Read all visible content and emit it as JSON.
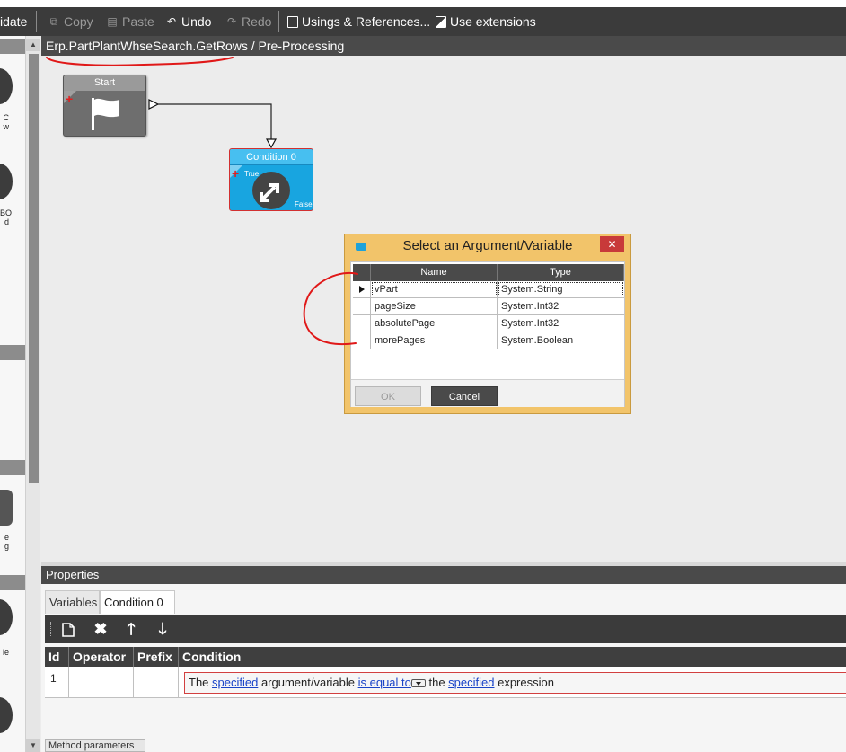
{
  "toolbar": {
    "validate_label": "idate",
    "copy_label": "Copy",
    "paste_label": "Paste",
    "undo_label": "Undo",
    "redo_label": "Redo",
    "usings_label": "Usings & References...",
    "extensions_label": "Use extensions"
  },
  "left_palette": {
    "items": [
      {
        "text": "C\nw"
      },
      {
        "text": "BO\nd"
      },
      {
        "text": "e\ng"
      },
      {
        "text": "le"
      }
    ]
  },
  "breadcrumb": {
    "method": "Erp.PartPlantWhseSearch.GetRows",
    "separator": " / ",
    "stage": "Pre-Processing"
  },
  "workflow": {
    "start_node": {
      "title": "Start"
    },
    "condition_node": {
      "title": "Condition 0",
      "true_label": "True",
      "false_label": "False"
    }
  },
  "dialog": {
    "title": "Select an Argument/Variable",
    "close_label": "✕",
    "columns": [
      "Name",
      "Type"
    ],
    "rows": [
      {
        "name": "vPart",
        "type": "System.String",
        "selected": true
      },
      {
        "name": "pageSize",
        "type": "System.Int32",
        "selected": false
      },
      {
        "name": "absolutePage",
        "type": "System.Int32",
        "selected": false
      },
      {
        "name": "morePages",
        "type": "System.Boolean",
        "selected": false
      }
    ],
    "ok_label": "OK",
    "cancel_label": "Cancel"
  },
  "properties": {
    "title": "Properties",
    "tabs": [
      "Variables",
      "Condition 0"
    ],
    "active_tab": "Condition 0",
    "toolbar_icons": [
      "new-document-icon",
      "delete-icon",
      "move-up-icon",
      "move-down-icon"
    ],
    "columns": [
      "Id",
      "Operator",
      "Prefix",
      "Condition"
    ],
    "rows": [
      {
        "id": "1",
        "operator": "",
        "prefix": "",
        "condition": {
          "part1": "The ",
          "link1": "specified",
          "part2": " argument/variable ",
          "link2": "is equal to",
          "part3": " the ",
          "link3": "specified",
          "part4": " expression"
        }
      }
    ],
    "bottom_tab": "Method parameters"
  },
  "colors": {
    "toolbar_bg": "#3b3b3b",
    "condition_node": "#18a5e0",
    "dialog_frame": "#f2c46a",
    "close_button": "#c83a3a",
    "annotation_red": "#e01818",
    "link": "#1a44c8"
  }
}
